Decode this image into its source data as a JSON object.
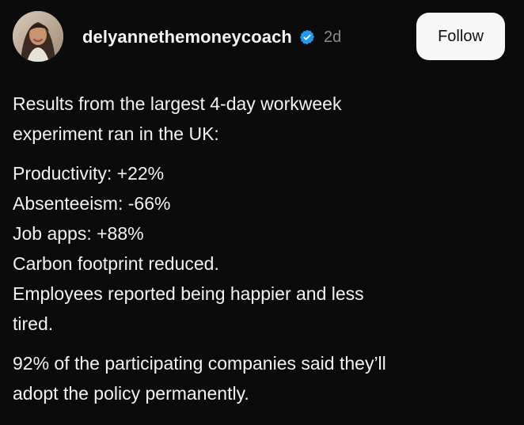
{
  "post": {
    "author": {
      "username": "delyannethemoneycoach",
      "verified": true,
      "time_ago": "2d",
      "avatar_icon": "profile-photo"
    },
    "follow_label": "Follow",
    "paragraphs": [
      {
        "lines": [
          "Results from the largest 4-day workweek",
          "experiment ran in the UK:"
        ]
      },
      {
        "lines": [
          "Productivity: +22%",
          "Absenteeism: -66%",
          "Job apps: +88%",
          "Carbon footprint reduced.",
          "Employees reported being happier and less",
          "tired."
        ]
      },
      {
        "lines": [
          "92% of the participating companies said they’ll",
          "adopt the policy permanently."
        ]
      }
    ]
  },
  "colors": {
    "background": "#0b0b0b",
    "text": "#f2f2f2",
    "muted": "#8b8b8b",
    "verified_blue": "#1d9bf0",
    "button_bg": "#f7f7f7"
  }
}
